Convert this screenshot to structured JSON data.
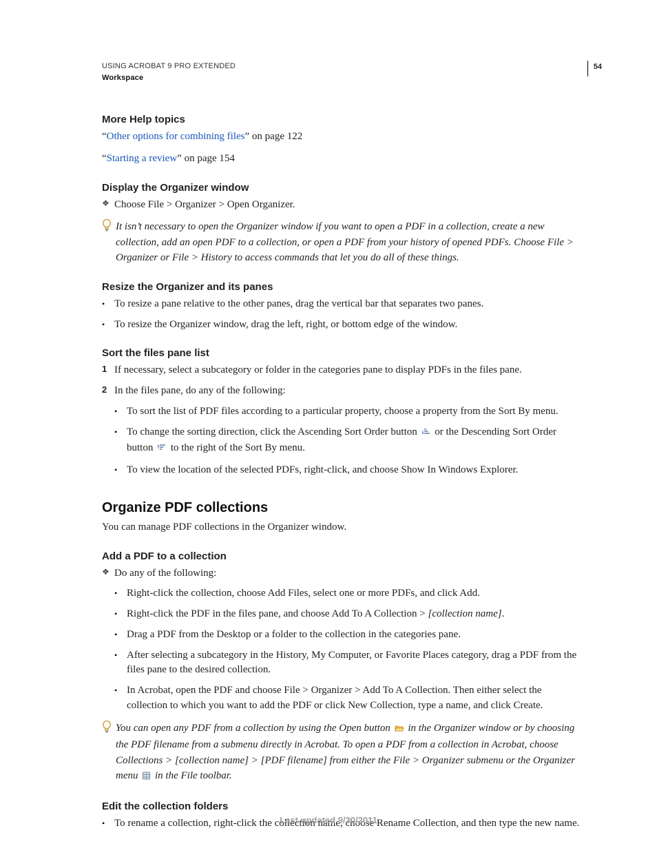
{
  "header": {
    "line1": "USING ACROBAT 9 PRO EXTENDED",
    "line2": "Workspace",
    "pageNumber": "54"
  },
  "moreHelp": {
    "heading": "More Help topics",
    "items": [
      {
        "q1": "“",
        "link": "Other options for combining files",
        "q2": "”",
        "after": " on page 122"
      },
      {
        "q1": "“",
        "link": "Starting a review",
        "q2": "”",
        "after": " on page 154"
      }
    ]
  },
  "sec1": {
    "heading": "Display the Organizer window",
    "bullet1": "Choose File > Organizer > Open Organizer.",
    "tip": "It isn’t necessary to open the Organizer window if you want to open a PDF in a collection, create a new collection, add an open PDF to a collection, or open a PDF from your history of opened PDFs. Choose File > Organizer or File > History to access commands that let you do all of these things."
  },
  "sec2": {
    "heading": "Resize the Organizer and its panes",
    "bullet1": "To resize a pane relative to the other panes, drag the vertical bar that separates two panes.",
    "bullet2": "To resize the Organizer window, drag the left, right, or bottom edge of the window."
  },
  "sec3": {
    "heading": "Sort the files pane list",
    "num1": "If necessary, select a subcategory or folder in the categories pane to display PDFs in the files pane.",
    "num2": "In the files pane, do any of the following:",
    "sub1": "To sort the list of PDF files according to a particular property, choose a property from the Sort By menu.",
    "sub2a": "To change the sorting direction, click the Ascending Sort Order button ",
    "sub2b": " or the Descending Sort Order button ",
    "sub2c": " to the right of the Sort By menu.",
    "sub3": "To view the location of the selected PDFs, right-click, and choose Show In Windows Explorer."
  },
  "sec4": {
    "heading": "Organize PDF collections",
    "intro": "You can manage PDF collections in the Organizer window."
  },
  "sec5": {
    "heading": "Add a PDF to a collection",
    "bullet1": "Do any of the following:",
    "sub1": "Right-click the collection, choose Add Files, select one or more PDFs, and click Add.",
    "sub2a": "Right-click the PDF in the files pane, and choose Add To A Collection > ",
    "sub2b": "[collection name]",
    "sub2c": ".",
    "sub3": "Drag a PDF from the Desktop or a folder to the collection in the categories pane.",
    "sub4": "After selecting a subcategory in the History, My Computer, or Favorite Places category, drag a PDF from the files pane to the desired collection.",
    "sub5": "In Acrobat, open the PDF and choose File > Organizer > Add To A Collection. Then either select the collection to which you want to add the PDF or click New Collection, type a name, and click Create.",
    "tip_a": "You can open any PDF from a collection by using the Open button ",
    "tip_b": " in the Organizer window or by choosing the PDF filename from a submenu directly in Acrobat. To open a PDF from a collection in Acrobat, choose Collections > [collection name] > [PDF filename] from either the File > Organizer submenu or the Organizer menu ",
    "tip_c": " in the File toolbar."
  },
  "sec6": {
    "heading": "Edit the collection folders",
    "bullet1": "To rename a collection, right-click the collection name, choose Rename Collection, and then type the new name."
  },
  "footer": "Last updated 9/30/2011"
}
